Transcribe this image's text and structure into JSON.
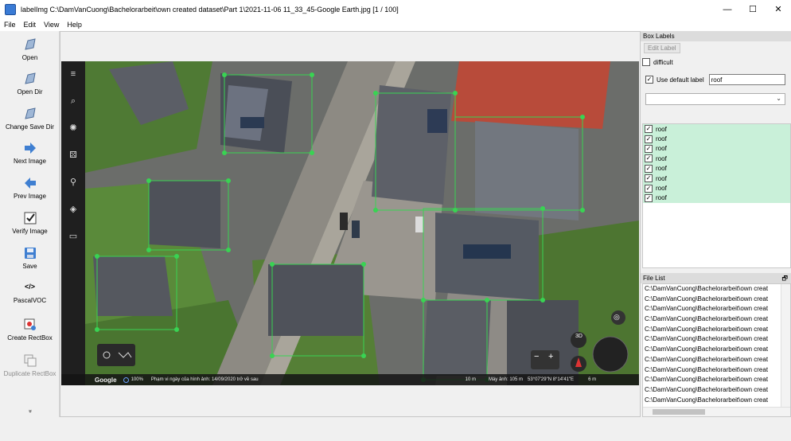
{
  "window": {
    "title": "labelImg C:\\DamVanCuong\\Bachelorarbeit\\own created dataset\\Part 1\\2021-11-06 11_33_45-Google Earth.jpg [1 / 100]",
    "minimize": "—",
    "maximize": "☐",
    "close": "✕"
  },
  "menu": [
    "File",
    "Edit",
    "View",
    "Help"
  ],
  "toolbar": {
    "open": "Open",
    "open_dir": "Open Dir",
    "change_save_dir": "Change Save Dir",
    "next_image": "Next Image",
    "prev_image": "Prev Image",
    "verify_image": "Verify Image",
    "save": "Save",
    "format_icon": "</>",
    "format": "PascalVOC",
    "create_rectbox": "Create RectBox",
    "duplicate_rectbox": "Duplicate RectBox",
    "more": "»"
  },
  "box_labels": {
    "header": "Box Labels",
    "edit_label": "Edit Label",
    "difficult": "difficult",
    "use_default_label": "Use default label",
    "default_label_value": "roof",
    "labels": [
      "roof",
      "roof",
      "roof",
      "roof",
      "roof",
      "roof",
      "roof",
      "roof"
    ]
  },
  "file_list": {
    "header": "File List",
    "float_icon": "🗗",
    "files": [
      "C:\\DamVanCuong\\Bachelorarbeit\\own creat",
      "C:\\DamVanCuong\\Bachelorarbeit\\own creat",
      "C:\\DamVanCuong\\Bachelorarbeit\\own creat",
      "C:\\DamVanCuong\\Bachelorarbeit\\own creat",
      "C:\\DamVanCuong\\Bachelorarbeit\\own creat",
      "C:\\DamVanCuong\\Bachelorarbeit\\own creat",
      "C:\\DamVanCuong\\Bachelorarbeit\\own creat",
      "C:\\DamVanCuong\\Bachelorarbeit\\own creat",
      "C:\\DamVanCuong\\Bachelorarbeit\\own creat",
      "C:\\DamVanCuong\\Bachelorarbeit\\own creat",
      "C:\\DamVanCuong\\Bachelorarbeit\\own creat",
      "C:\\DamVanCuong\\Bachelorarbeit\\own creat"
    ]
  },
  "google_earth": {
    "logo": "Google",
    "zoom": "100%",
    "imagery_note": "Phạm vi ngày của hình ảnh: 14/09/2020 trở về sau",
    "scale": "10 m",
    "camera": "Máy ảnh: 105 m",
    "coords": "53°07'29\"N 8°14'41\"E",
    "elevation": "6 m",
    "btn_3d": "3D",
    "zoom_minus": "−",
    "zoom_plus": "+"
  },
  "colors": {
    "bbox": "#39d353",
    "label_bg": "#c9f0d9",
    "accent": "#3a7bd5"
  }
}
